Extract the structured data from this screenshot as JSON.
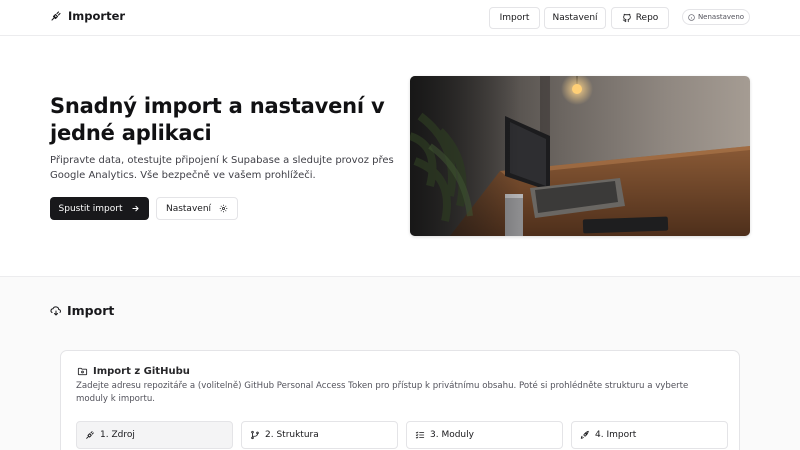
{
  "header": {
    "brand_name": "Importer",
    "brand_icon": "plug-icon",
    "nav": {
      "import_label": "Import",
      "settings_label": "Nastavení",
      "repo_label": "Repo"
    },
    "status": "Nenastaveno"
  },
  "hero": {
    "title": "Snadný import a nastavení v jedné aplikaci",
    "description": "Připravte data, otestujte připojení k Supabase a sledujte provoz přes Google Analytics. Vše bezpečně ve vašem prohlížeči.",
    "primary_button": "Spustit import",
    "secondary_button": "Nastavení"
  },
  "import_section": {
    "title": "Import",
    "card": {
      "title": "Import z GitHubu",
      "description": "Zadejte adresu repozitáře a (volitelně) GitHub Personal Access Token pro přístup k privátnímu obsahu. Poté si prohlédněte strukturu a vyberte moduly k importu.",
      "steps": [
        {
          "label": "1. Zdroj",
          "icon": "plug-icon",
          "active": true
        },
        {
          "label": "2. Struktura",
          "icon": "git-branch-icon",
          "active": false
        },
        {
          "label": "3. Moduly",
          "icon": "list-check-icon",
          "active": false
        },
        {
          "label": "4. Import",
          "icon": "rocket-icon",
          "active": false
        }
      ]
    }
  },
  "colors": {
    "primary": "#18181b",
    "border": "#e4e4e7",
    "background": "#fafafa"
  }
}
